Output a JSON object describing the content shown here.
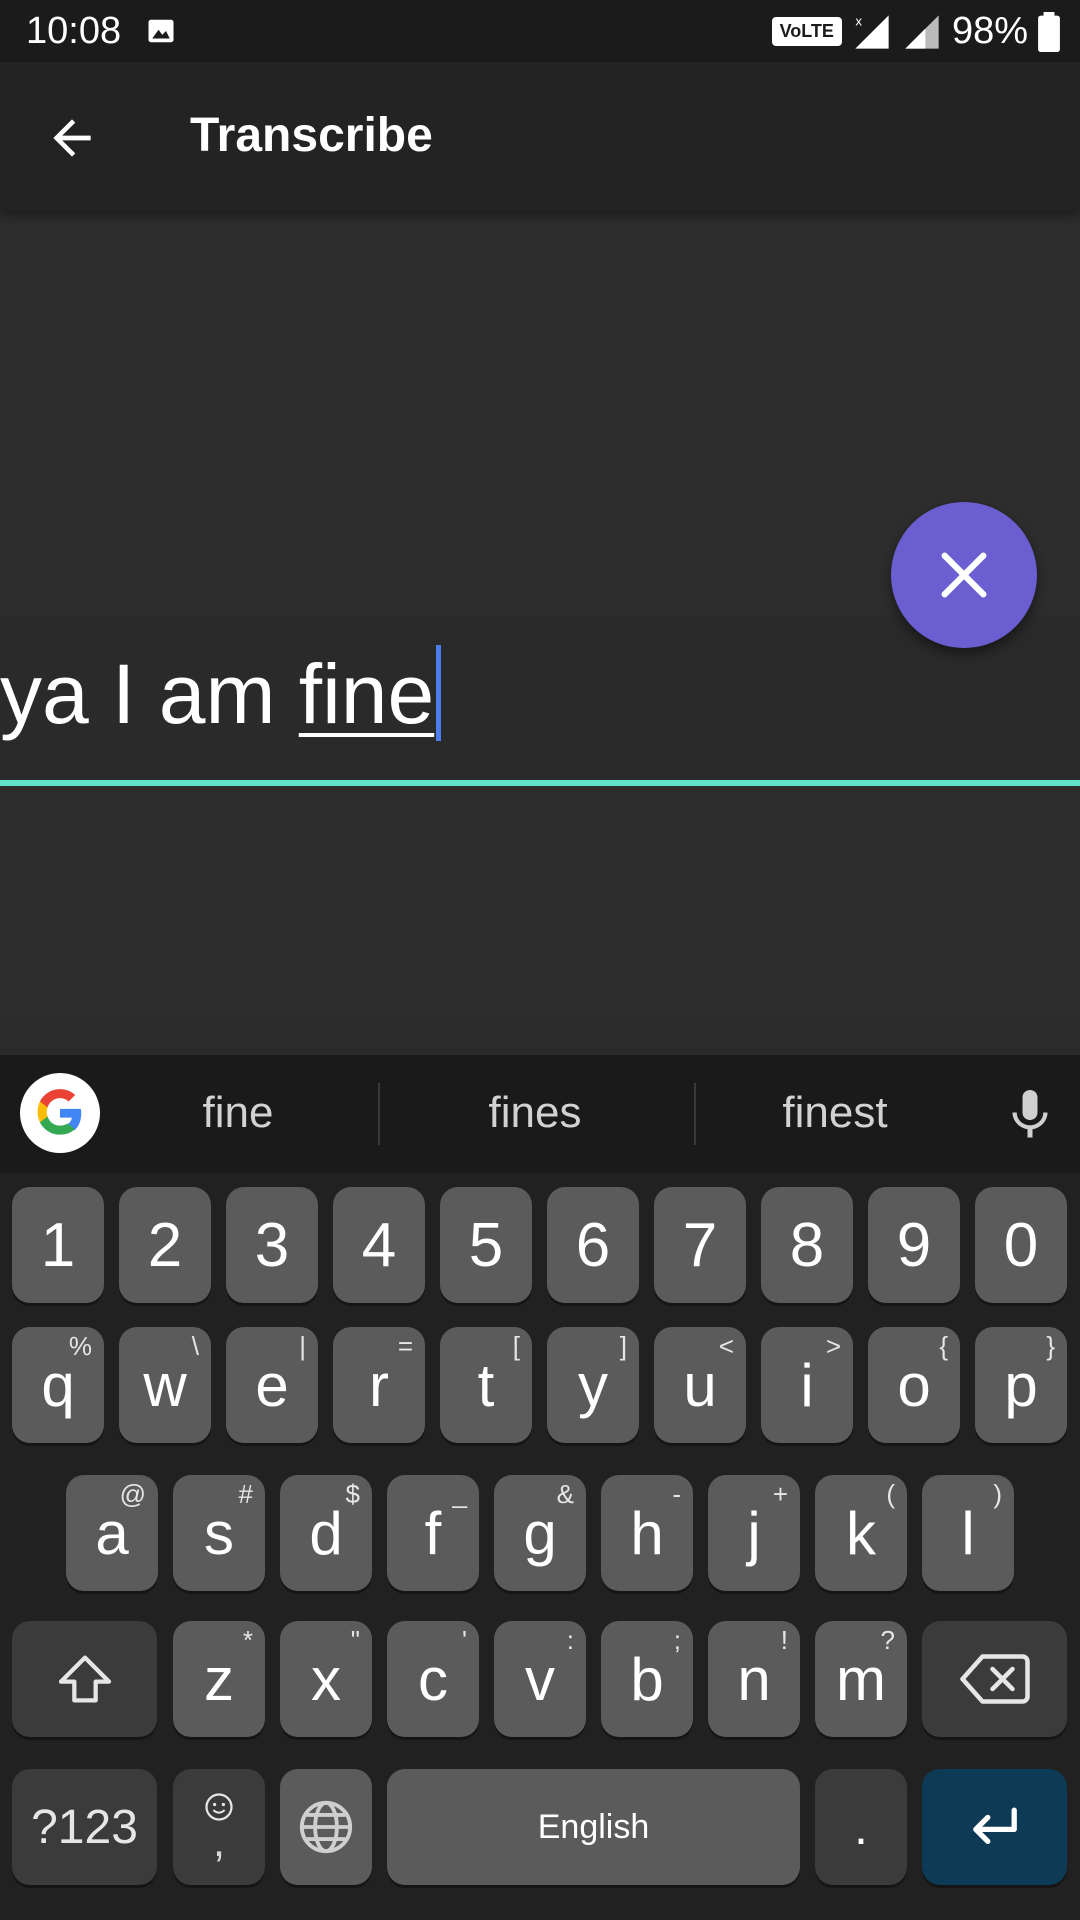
{
  "status_bar": {
    "time": "10:08",
    "network": "VoLTE",
    "battery": "98%"
  },
  "app_bar": {
    "title": "Transcribe"
  },
  "input": {
    "text_before": "ya I am ",
    "current_word": "fine"
  },
  "suggestions": [
    "fine",
    "fines",
    "finest"
  ],
  "keyboard": {
    "number_row": [
      "1",
      "2",
      "3",
      "4",
      "5",
      "6",
      "7",
      "8",
      "9",
      "0"
    ],
    "row1": [
      {
        "k": "q",
        "h": "%"
      },
      {
        "k": "w",
        "h": "\\"
      },
      {
        "k": "e",
        "h": "|"
      },
      {
        "k": "r",
        "h": "="
      },
      {
        "k": "t",
        "h": "["
      },
      {
        "k": "y",
        "h": "]"
      },
      {
        "k": "u",
        "h": "<"
      },
      {
        "k": "i",
        "h": ">"
      },
      {
        "k": "o",
        "h": "{"
      },
      {
        "k": "p",
        "h": "}"
      }
    ],
    "row2": [
      {
        "k": "a",
        "h": "@"
      },
      {
        "k": "s",
        "h": "#"
      },
      {
        "k": "d",
        "h": "$"
      },
      {
        "k": "f",
        "h": "_"
      },
      {
        "k": "g",
        "h": "&"
      },
      {
        "k": "h",
        "h": "-"
      },
      {
        "k": "j",
        "h": "+"
      },
      {
        "k": "k",
        "h": "("
      },
      {
        "k": "l",
        "h": ")"
      }
    ],
    "row3": [
      {
        "k": "z",
        "h": "*"
      },
      {
        "k": "x",
        "h": "\""
      },
      {
        "k": "c",
        "h": "'"
      },
      {
        "k": "v",
        "h": ":"
      },
      {
        "k": "b",
        "h": ";"
      },
      {
        "k": "n",
        "h": "!"
      },
      {
        "k": "m",
        "h": "?"
      }
    ],
    "symbols_label": "?123",
    "comma_label": ",",
    "space_label": "English",
    "period_label": "."
  },
  "colors": {
    "accent": "#6a5ed1",
    "underline": "#5fe3c8",
    "cursor": "#4a7eea",
    "enter": "#0d3a55"
  }
}
